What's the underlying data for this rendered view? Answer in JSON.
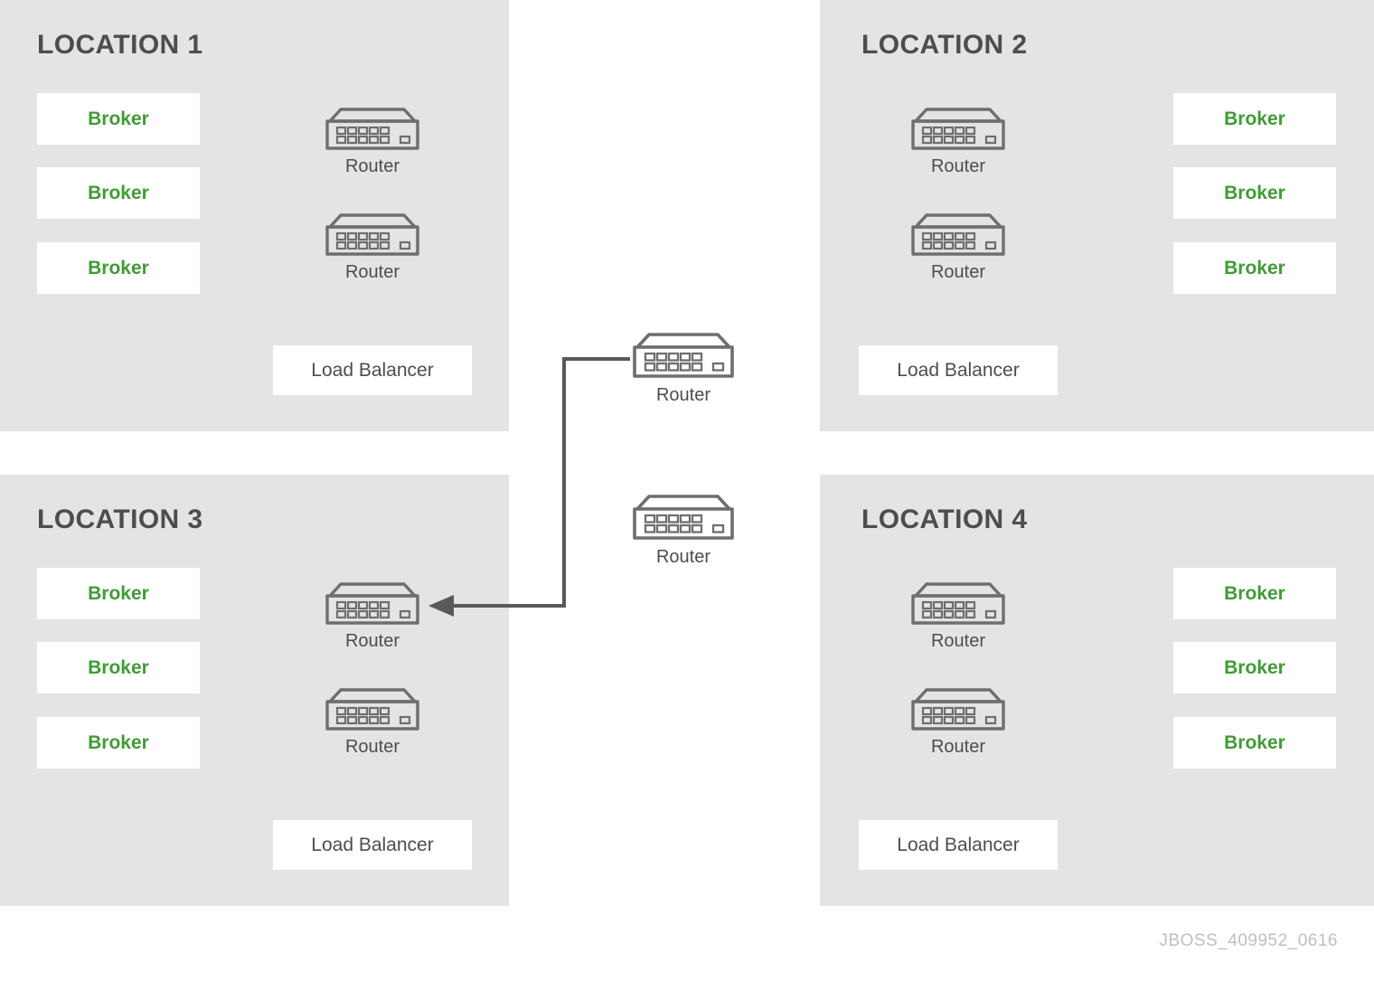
{
  "diagram": {
    "footer_code": "JBOSS_409952_0616",
    "colors": {
      "panel_background": "#e4e4e4",
      "page_background": "#ffffff",
      "box_background": "#ffffff",
      "broker_text": "#3f9c35",
      "title_text": "#4d4d4d",
      "label_text": "#4d4d4d",
      "icon_stroke": "#6e6e6e",
      "connector_line": "#58595b",
      "footer_text": "#bfbfbf"
    }
  },
  "locations": [
    {
      "id": "location-1",
      "title": "LOCATION 1",
      "brokers": [
        {
          "label": "Broker"
        },
        {
          "label": "Broker"
        },
        {
          "label": "Broker"
        }
      ],
      "routers": [
        {
          "label": "Router"
        },
        {
          "label": "Router"
        }
      ],
      "load_balancer": {
        "label": "Load Balancer"
      }
    },
    {
      "id": "location-2",
      "title": "LOCATION 2",
      "brokers": [
        {
          "label": "Broker"
        },
        {
          "label": "Broker"
        },
        {
          "label": "Broker"
        }
      ],
      "routers": [
        {
          "label": "Router"
        },
        {
          "label": "Router"
        }
      ],
      "load_balancer": {
        "label": "Load Balancer"
      }
    },
    {
      "id": "location-3",
      "title": "LOCATION 3",
      "brokers": [
        {
          "label": "Broker"
        },
        {
          "label": "Broker"
        },
        {
          "label": "Broker"
        }
      ],
      "routers": [
        {
          "label": "Router"
        },
        {
          "label": "Router"
        }
      ],
      "load_balancer": {
        "label": "Load Balancer"
      }
    },
    {
      "id": "location-4",
      "title": "LOCATION 4",
      "brokers": [
        {
          "label": "Broker"
        },
        {
          "label": "Broker"
        },
        {
          "label": "Broker"
        }
      ],
      "routers": [
        {
          "label": "Router"
        },
        {
          "label": "Router"
        }
      ],
      "load_balancer": {
        "label": "Load Balancer"
      }
    }
  ],
  "center_routers": [
    {
      "id": "center-router-top",
      "label": "Router"
    },
    {
      "id": "center-router-bottom",
      "label": "Router"
    }
  ],
  "connections": [
    {
      "id": "center-top-router-to-location-3-router",
      "from": "center-router-top",
      "to": "location-3-router-1",
      "arrow": "to"
    }
  ]
}
